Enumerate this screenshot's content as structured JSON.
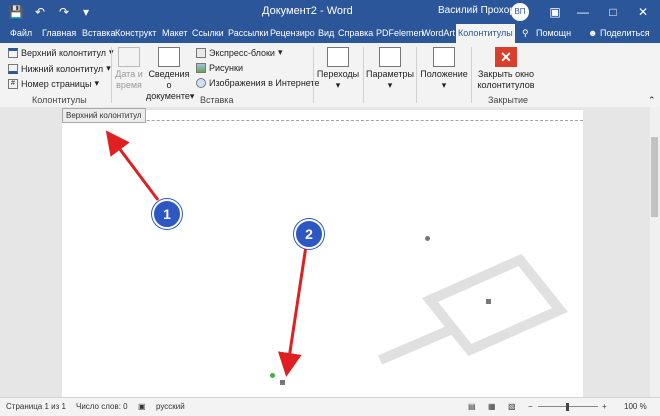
{
  "titlebar": {
    "doc_title": "Документ2 - Word",
    "user_name": "Василий Прохоров",
    "avatar_initials": "ВП"
  },
  "tabs": [
    {
      "label": "Файл"
    },
    {
      "label": "Главная"
    },
    {
      "label": "Вставка"
    },
    {
      "label": "Конструкт"
    },
    {
      "label": "Макет"
    },
    {
      "label": "Ссылки"
    },
    {
      "label": "Рассылки"
    },
    {
      "label": "Рецензиро"
    },
    {
      "label": "Вид"
    },
    {
      "label": "Справка"
    },
    {
      "label": "PDFelemen"
    },
    {
      "label": "WordArt"
    },
    {
      "label": "Колонтитулы"
    }
  ],
  "tab_extra": {
    "help": "Помощн",
    "share": "Поделиться"
  },
  "ribbon": {
    "header_footer": {
      "header": "Верхний колонтитул",
      "footer": "Нижний колонтитул",
      "page_number": "Номер страницы",
      "group_label": "Колонтитулы"
    },
    "insert": {
      "datetime_line1": "Дата и",
      "datetime_line2": "время",
      "docinfo_line1": "Сведения о",
      "docinfo_line2": "документе",
      "quickparts": "Экспресс-блоки",
      "pictures": "Рисунки",
      "online_pictures": "Изображения в Интернете",
      "group_label": "Вставка"
    },
    "navigation": {
      "label": "Переходы"
    },
    "options": {
      "label": "Параметры"
    },
    "position": {
      "label": "Положение"
    },
    "close": {
      "line1": "Закрыть окно",
      "line2": "колонтитулов",
      "group_label": "Закрытие"
    }
  },
  "document": {
    "header_tag": "Верхний колонтитул"
  },
  "annotations": {
    "badge1": "1",
    "badge2": "2"
  },
  "statusbar": {
    "page": "Страница 1 из 1",
    "words": "Число слов: 0",
    "language": "русский",
    "zoom": "100 %"
  },
  "colors": {
    "accent": "#2b579a",
    "arrow": "#e02020",
    "badge": "#2e57c4"
  }
}
